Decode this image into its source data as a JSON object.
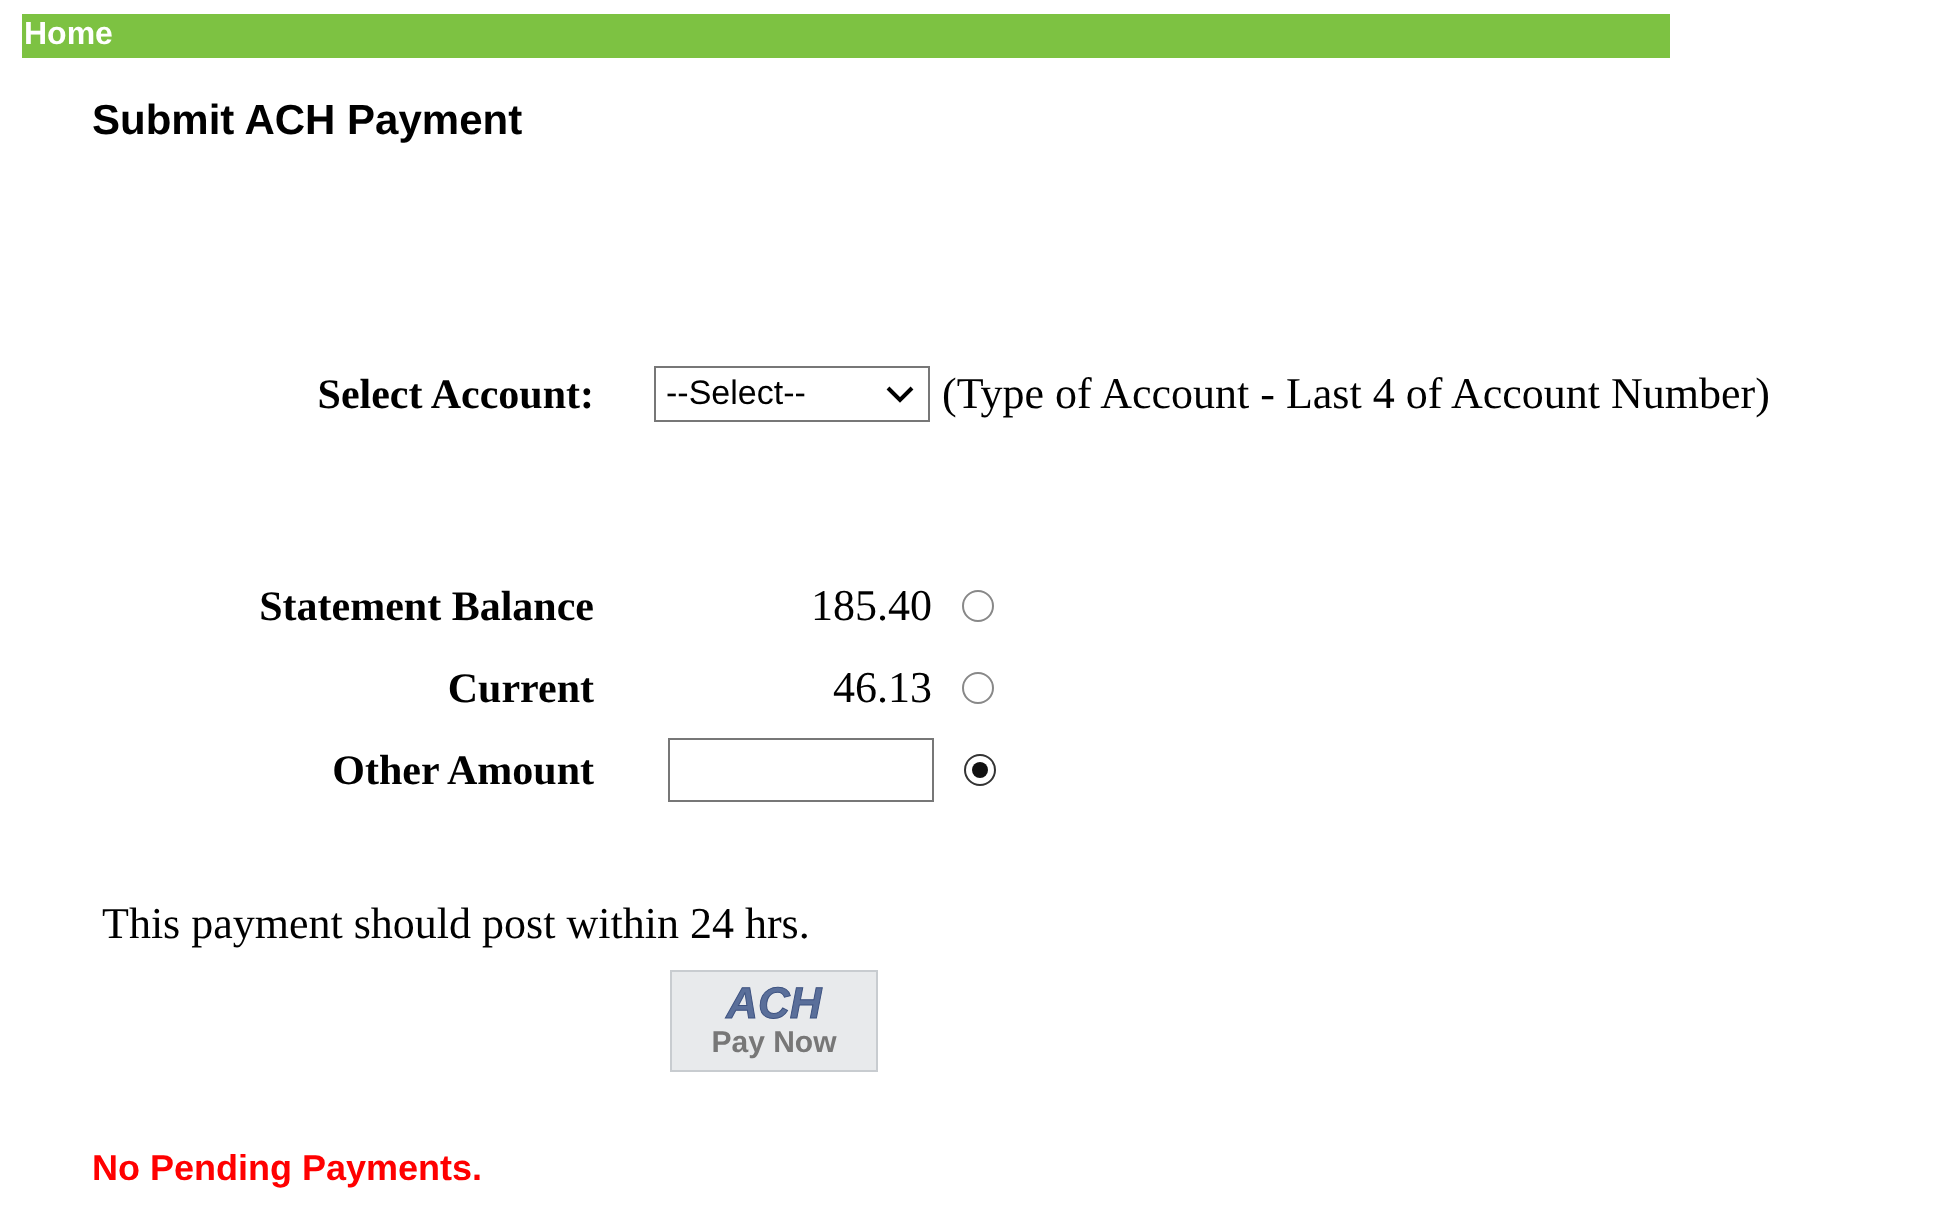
{
  "nav": {
    "label": "Home"
  },
  "title": "Submit ACH Payment",
  "account": {
    "label": "Select Account:",
    "value": "--Select--",
    "hint": "(Type of Account - Last 4 of Account Number)"
  },
  "amounts": [
    {
      "kind": "fixed",
      "label": "Statement Balance",
      "value": "185.40",
      "selected": false
    },
    {
      "kind": "fixed",
      "label": "Current",
      "value": "46.13",
      "selected": false
    },
    {
      "kind": "input",
      "label": "Other Amount",
      "selected": true
    }
  ],
  "note": "This payment should post within 24 hrs.",
  "pay_button": {
    "logo": "ACH",
    "label": "Pay Now"
  },
  "status": "No Pending Payments."
}
